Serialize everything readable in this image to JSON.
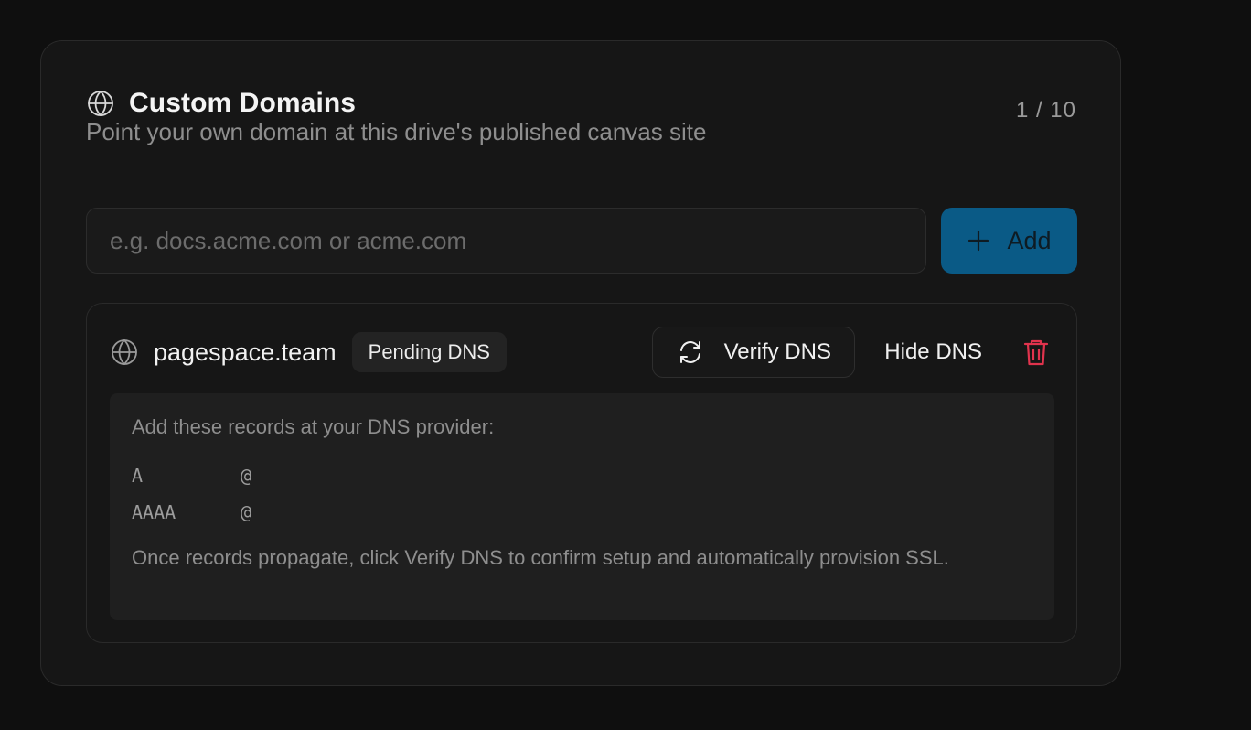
{
  "header": {
    "title": "Custom Domains",
    "subtitle": "Point your own domain at this drive's published canvas site",
    "count": "1 / 10",
    "icon": "globe-icon"
  },
  "add_form": {
    "placeholder": "e.g. docs.acme.com or acme.com",
    "value": "",
    "button_label": "Add",
    "button_icon": "plus-icon"
  },
  "domains": [
    {
      "name": "pagespace.team",
      "status": "Pending DNS",
      "verify_label": "Verify DNS",
      "hide_label": "Hide DNS",
      "dns": {
        "intro": "Add these records at your DNS provider:",
        "records": [
          {
            "type": "A",
            "name": "@"
          },
          {
            "type": "AAAA",
            "name": "@"
          }
        ],
        "note": "Once records propagate, click Verify DNS to confirm setup and automatically provision SSL."
      }
    }
  ],
  "colors": {
    "accent": "#0a5a86",
    "danger": "#e0334d",
    "background": "#0f0f0f",
    "card": "#161616"
  }
}
